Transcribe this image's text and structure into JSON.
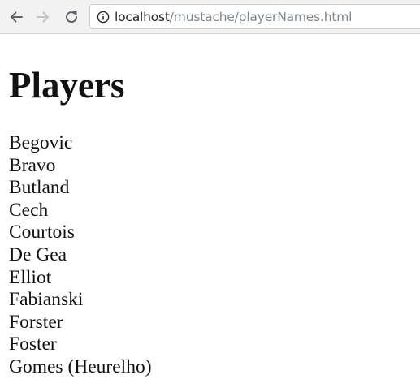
{
  "browser": {
    "url_host": "localhost",
    "url_path": "/mustache/playerNames.html",
    "icons": {
      "back": "back-arrow-icon",
      "forward": "forward-arrow-icon",
      "reload": "reload-icon",
      "info": "info-icon"
    }
  },
  "page": {
    "heading": "Players",
    "players": [
      "Begovic",
      "Bravo",
      "Butland",
      "Cech",
      "Courtois",
      "De Gea",
      "Elliot",
      "Fabianski",
      "Forster",
      "Foster",
      "Gomes (Heurelho)"
    ]
  }
}
